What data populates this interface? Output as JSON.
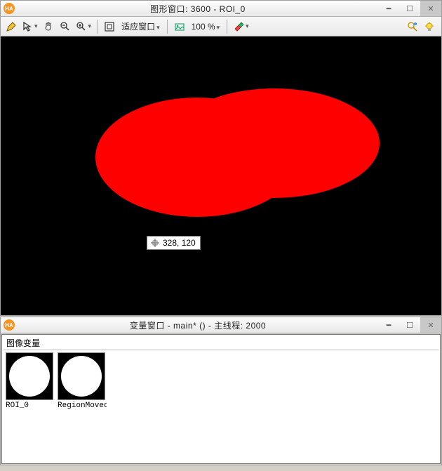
{
  "graphics_window": {
    "title": "图形窗口: 3600 - ROI_0",
    "toolbar": {
      "fit_label": "适应窗口",
      "zoom_value": "100 %"
    },
    "coord_label": "328, 120"
  },
  "variable_window": {
    "title": "变量窗口 - main* () - 主线程: 2000",
    "section_label": "图像变量",
    "thumbs": [
      {
        "caption": "ROI_0"
      },
      {
        "caption": "RegionMoved"
      }
    ]
  }
}
